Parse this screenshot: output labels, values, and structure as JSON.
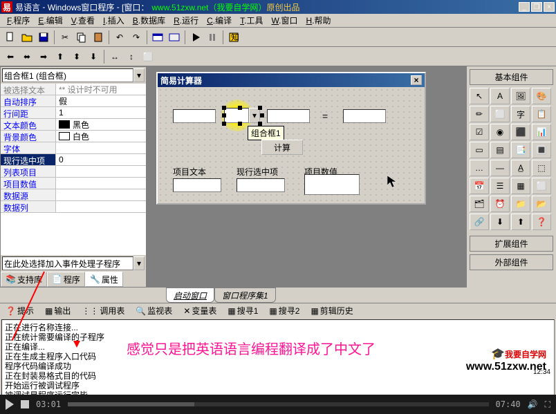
{
  "title": {
    "app": "易语言",
    "doc": "Windows窗口程序",
    "window_prefix": "[窗口：",
    "url": "www.51zxw.net（我要自学网）",
    "suffix": "原创出品"
  },
  "menu": [
    "程序",
    "编辑",
    "查看",
    "插入",
    "数据库",
    "运行",
    "编译",
    "工具",
    "窗口",
    "帮助"
  ],
  "menu_keys": [
    "F",
    "E",
    "V",
    "I",
    "B",
    "R",
    "C",
    "T",
    "W",
    "H"
  ],
  "left": {
    "combo": "组合框1 (组合框)",
    "props": [
      {
        "name": "被选择文本",
        "val": "** 设计时不可用",
        "disabled": true
      },
      {
        "name": "自动排序",
        "val": "假"
      },
      {
        "name": "行间距",
        "val": "1"
      },
      {
        "name": "文本颜色",
        "val": "黑色",
        "color": "#000000"
      },
      {
        "name": "背景颜色",
        "val": "白色",
        "color": "#ffffff"
      },
      {
        "name": "字体",
        "val": ""
      },
      {
        "name": "现行选中项",
        "val": "0",
        "highlight": true
      },
      {
        "name": "列表项目",
        "val": ""
      },
      {
        "name": "项目数值",
        "val": ""
      },
      {
        "name": "数据源",
        "val": ""
      },
      {
        "name": "数据列",
        "val": ""
      }
    ],
    "event_combo": "在此处选择加入事件处理子程序",
    "tabs": [
      "支持库",
      "程序",
      "属性"
    ]
  },
  "designer": {
    "title": "简易计算器",
    "equals": "=",
    "tooltip": "组合框1",
    "calc_btn": "计算",
    "labels": [
      "项目文本",
      "现行选中项",
      "项目数值"
    ]
  },
  "right": {
    "header": "基本组件",
    "footer1": "扩展组件",
    "footer2": "外部组件"
  },
  "bottom_tabs": [
    "启动窗口",
    "窗口程序集1"
  ],
  "output": {
    "tabs": [
      "提示",
      "输出",
      "调用表",
      "监视表",
      "变量表",
      "搜寻1",
      "搜寻2",
      "剪辑历史"
    ],
    "lines": [
      "正在进行名称连接...",
      "正在统计需要编译的子程序",
      "正在编译...",
      "正在生成主程序入口代码",
      "程序代码编译成功",
      "正在封装易格式目的代码",
      "开始运行被调试程序",
      "被调试易程序运行完毕"
    ],
    "annotation": "感觉只是把英语语言编程翻译成了中文了"
  },
  "watermark": {
    "l1": "我要自学网",
    "l2": "www.51zxw.net"
  },
  "clock": "12:34",
  "player": {
    "current": "03:01",
    "total": "07:40"
  }
}
